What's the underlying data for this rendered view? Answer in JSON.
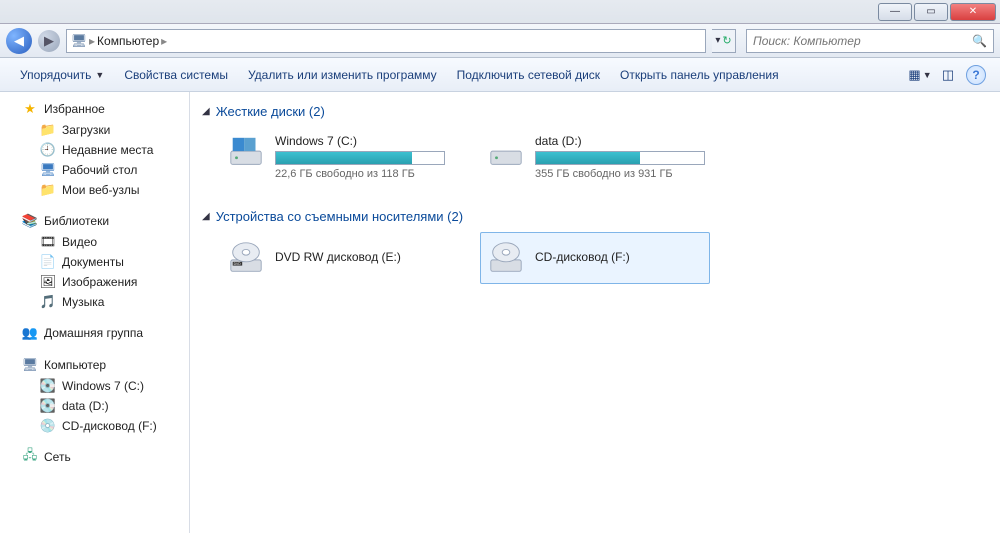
{
  "titlebar": {
    "min": "—",
    "max": "▭",
    "close": "✕"
  },
  "breadcrumb": {
    "root": "Компьютер",
    "arrow": "▸"
  },
  "search": {
    "placeholder": "Поиск: Компьютер"
  },
  "toolbar": {
    "organize": "Упорядочить",
    "properties": "Свойства системы",
    "uninstall": "Удалить или изменить программу",
    "map_drive": "Подключить сетевой диск",
    "control_panel": "Открыть панель управления"
  },
  "sidebar": {
    "favorites": {
      "head": "Избранное",
      "items": [
        "Загрузки",
        "Недавние места",
        "Рабочий стол",
        "Мои веб-узлы"
      ]
    },
    "libraries": {
      "head": "Библиотеки",
      "items": [
        "Видео",
        "Документы",
        "Изображения",
        "Музыка"
      ]
    },
    "homegroup": "Домашняя группа",
    "computer": {
      "head": "Компьютер",
      "items": [
        "Windows 7 (C:)",
        "data (D:)",
        "CD-дисковод (F:)"
      ]
    },
    "network": "Сеть"
  },
  "sections": {
    "hdd": {
      "title": "Жесткие диски (2)"
    },
    "removable": {
      "title": "Устройства со съемными носителями (2)"
    }
  },
  "drives": {
    "c": {
      "name": "Windows 7 (C:)",
      "free": "22,6 ГБ свободно из 118 ГБ",
      "used_pct": 81
    },
    "d": {
      "name": "data (D:)",
      "free": "355 ГБ свободно из 931 ГБ",
      "used_pct": 62
    }
  },
  "removable": {
    "e": {
      "name": "DVD RW дисковод (E:)"
    },
    "f": {
      "name": "CD-дисковод (F:)"
    }
  }
}
